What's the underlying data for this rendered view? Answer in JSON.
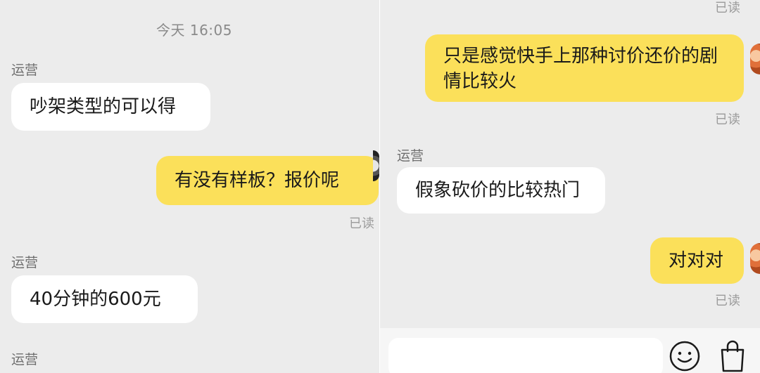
{
  "chat_left": {
    "timestamp": "今天 16:05",
    "messages": [
      {
        "sender": "运营",
        "text": "吵架类型的可以得"
      },
      {
        "text": "有没有样板？报价呢",
        "status": "已读"
      },
      {
        "sender": "运营",
        "text": "40分钟的600元"
      },
      {
        "sender": "运营"
      }
    ]
  },
  "chat_right": {
    "top_status": "已读",
    "messages": [
      {
        "text": "只是感觉快手上那种讨价还价的剧情比较火",
        "status": "已读"
      },
      {
        "sender": "运营",
        "text": "假象砍价的比较热门"
      },
      {
        "text": "对对对",
        "status": "已读"
      }
    ]
  },
  "input_bar": {
    "placeholder": "",
    "emoji_icon": "emoji-icon",
    "bag_icon": "shopping-bag-icon"
  },
  "colors": {
    "background": "#ececec",
    "incoming_bubble": "#ffffff",
    "outgoing_bubble": "#fbe05a"
  }
}
